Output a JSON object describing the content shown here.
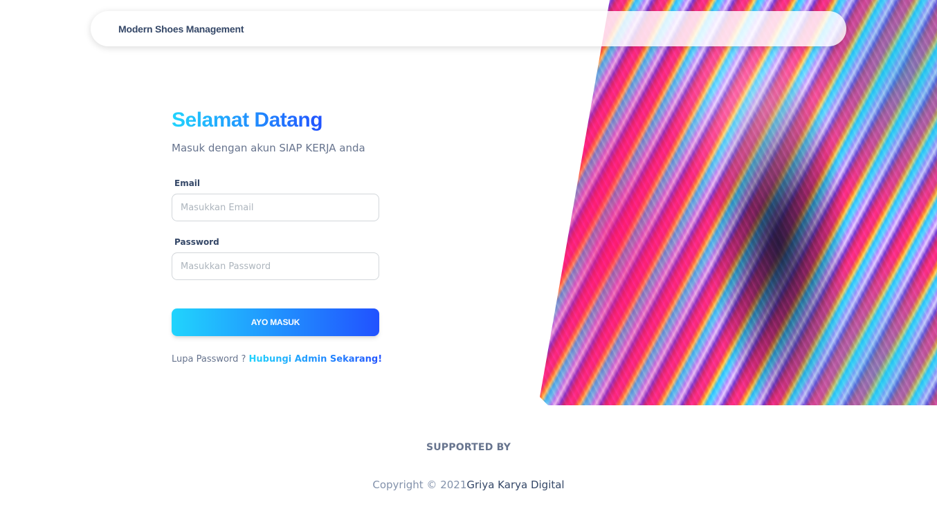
{
  "navbar": {
    "brand": "Modern Shoes Management"
  },
  "login": {
    "title": "Selamat Datang",
    "subtitle": "Masuk dengan akun SIAP KERJA anda",
    "email": {
      "label": "Email",
      "placeholder": "Masukkan Email",
      "value": ""
    },
    "password": {
      "label": "Password",
      "placeholder": "Masukkan Password",
      "value": ""
    },
    "submit_label": "AYO MASUK",
    "forgot_text": "Lupa Password ?",
    "forgot_link": "Hubungi Admin Sekarang!"
  },
  "footer": {
    "supported_by": "SUPPORTED BY",
    "copyright": "Copyright © 2021",
    "company": "Griya Karya Digital"
  },
  "colors": {
    "gradient_start": "#21d4fd",
    "gradient_end": "#2152ff",
    "text_dark": "#344767",
    "text_muted": "#67748e"
  }
}
